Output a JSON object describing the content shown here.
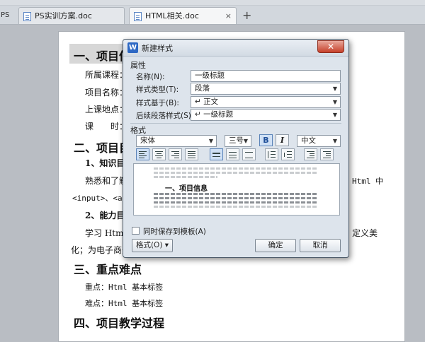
{
  "tabs": {
    "app_stub": "PS",
    "doc1": "PS实训方案.doc",
    "doc2": "HTML相关.doc",
    "close_glyph": "×",
    "new_tab": "+"
  },
  "document": {
    "heading1": "一、项目信",
    "line_course": "所属课程：",
    "line_project": "项目名称：",
    "line_location": "上课地点：",
    "line_time": "课　　时：",
    "heading2": "二、项目目",
    "sub1": "1、知识目标",
    "para1": "熟悉和了解",
    "para1_tail": "Html 中",
    "para2": "<input>、<a>等",
    "sub2": "2、能力目标",
    "para3": "学习 Html 的",
    "para3_tail": "定义美",
    "para4": "化；为电子商务",
    "heading3": "三、重点难点",
    "key_point": "重点：Html 基本标签",
    "difficulty": "难点：Html 基本标签",
    "heading4": "四、项目教学过程"
  },
  "dialog": {
    "title": "新建样式",
    "app_icon": "W",
    "close": "✕",
    "attributes_title": "属性",
    "name_label": "名称(N):",
    "name_value": "一级标题",
    "type_label": "样式类型(T):",
    "type_value": "段落",
    "based_label": "样式基于(B):",
    "based_value": "↵ 正文",
    "next_label": "后续段落样式(S):",
    "next_value": "↵ 一级标题",
    "format_title": "格式",
    "font_value": "宋体",
    "size_value": "三号",
    "bold": "B",
    "italic": "I",
    "lang_value": "中文",
    "preview_text": "一、项目信息",
    "save_template_label": "同时保存到模板(A)",
    "format_button": "格式(O) ▾",
    "ok_button": "确定",
    "cancel_button": "取消",
    "dropdown_arrow": "▼"
  }
}
